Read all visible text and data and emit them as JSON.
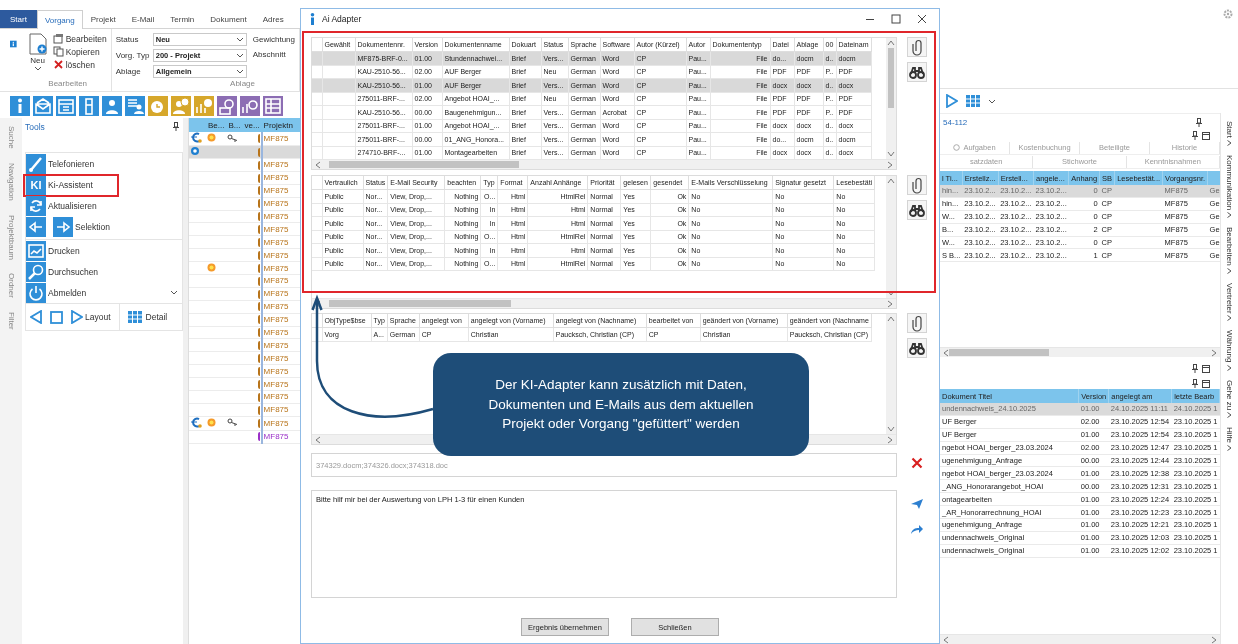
{
  "ribbon_tabs": [
    {
      "label": "Start",
      "kind": "file",
      "selected": false
    },
    {
      "label": "Vorgang",
      "kind": "tab",
      "selected": true
    },
    {
      "label": "Projekt",
      "kind": "tab",
      "selected": false
    },
    {
      "label": "E-Mail",
      "kind": "tab",
      "selected": false
    },
    {
      "label": "Termin",
      "kind": "tab",
      "selected": false
    },
    {
      "label": "Dokument",
      "kind": "tab",
      "selected": false
    },
    {
      "label": "Adres",
      "kind": "tab",
      "selected": false
    }
  ],
  "ribbon": {
    "new_label": "Neu",
    "actions": [
      "Bearbeiten",
      "Kopieren",
      "löschen"
    ],
    "edit_group": "Bearbeiten",
    "fields": [
      {
        "label": "Status",
        "value": "Neu"
      },
      {
        "label": "Vorg. Typ",
        "value": "200 - Projekt"
      },
      {
        "label": "Ablage",
        "value": "Allgemein"
      }
    ],
    "more_labels": [
      "Gewichtung",
      "Abschnitt"
    ],
    "filing_group": "Ablage"
  },
  "side_tabs_left": [
    "Suche",
    "Navigation",
    "Projektbaum",
    "Ordner",
    "Filter"
  ],
  "tools": {
    "title": "Tools",
    "items": [
      {
        "label": "Telefonieren",
        "highlighted": false
      },
      {
        "label": "Ki-Assistent",
        "badge": "KI",
        "highlighted": true
      },
      {
        "label": "Aktualisieren",
        "highlighted": false
      },
      {
        "label": "Selektion",
        "highlighted": false
      },
      {
        "label": "Drucken",
        "highlighted": false
      },
      {
        "label": "Durchsuchen",
        "highlighted": false
      },
      {
        "label": "Abmelden",
        "highlighted": false
      }
    ],
    "layout_label": "Layout",
    "detail_label": "Detail"
  },
  "project_grid": {
    "columns": [
      "Be...",
      "B...",
      "ve...",
      "Projektn"
    ],
    "rows": [
      {
        "kind": "full",
        "project": "MF875",
        "color": "#b8741a",
        "selected": false
      },
      {
        "kind": "config",
        "color": "#b8741a",
        "selected": true
      },
      {
        "kind": "plain",
        "project": "MF875",
        "color": "#b8741a",
        "selected": false
      },
      {
        "kind": "plain",
        "project": "MF875",
        "color": "#b8741a",
        "selected": false
      },
      {
        "kind": "plain",
        "project": "MF875",
        "color": "#b8741a",
        "selected": false
      },
      {
        "kind": "plain",
        "project": "MF875",
        "color": "#b8741a",
        "selected": false
      },
      {
        "kind": "plain",
        "project": "MF875",
        "color": "#b8741a",
        "selected": false
      },
      {
        "kind": "plain",
        "project": "MF875",
        "color": "#b8741a",
        "selected": false
      },
      {
        "kind": "plain",
        "project": "MF875",
        "color": "#b8741a",
        "selected": false
      },
      {
        "kind": "plain",
        "project": "MF875",
        "color": "#b8741a",
        "selected": false
      },
      {
        "kind": "sun",
        "project": "MF875",
        "color": "#b8741a",
        "selected": false
      },
      {
        "kind": "plain",
        "project": "MF875",
        "color": "#b8741a",
        "selected": false
      },
      {
        "kind": "plain",
        "project": "MF875",
        "color": "#b8741a",
        "selected": false
      },
      {
        "kind": "plain",
        "project": "MF875",
        "color": "#b8741a",
        "selected": false
      },
      {
        "kind": "plain",
        "project": "MF875",
        "color": "#b8741a",
        "selected": false
      },
      {
        "kind": "plain",
        "project": "MF875",
        "color": "#b8741a",
        "selected": false
      },
      {
        "kind": "plain",
        "project": "MF875",
        "color": "#b8741a",
        "selected": false
      },
      {
        "kind": "plain",
        "project": "MF875",
        "color": "#b8741a",
        "selected": false
      },
      {
        "kind": "plain",
        "project": "MF875",
        "color": "#b8741a",
        "selected": false
      },
      {
        "kind": "plain",
        "project": "MF875",
        "color": "#b8741a",
        "selected": false
      },
      {
        "kind": "plain",
        "project": "MF875",
        "color": "#b8741a",
        "selected": false
      },
      {
        "kind": "plain",
        "project": "MF875",
        "color": "#b8741a",
        "selected": false
      },
      {
        "kind": "full",
        "project": "MF875",
        "color": "#b8741a",
        "selected": false
      },
      {
        "kind": "plain",
        "project": "MF875",
        "color": "#9b30c8",
        "selected": false
      }
    ]
  },
  "dialog": {
    "title": "Ai Adapter",
    "highlighted": true,
    "documents": {
      "columns": [
        "Gewählt",
        "Dokumentennr.",
        "Version",
        "Dokumentenname",
        "Dokuart",
        "Status",
        "Sprache",
        "Software",
        "Autor (Kürzel)",
        "Autor",
        "Dokumententyp",
        "Datei",
        "Ablage",
        "00",
        "Dateinam"
      ],
      "rows": [
        {
          "cells": [
            null,
            "MF875-BRF-0...",
            "01.00",
            "Stundennachwei...",
            "Brief",
            "Vers...",
            "German",
            "Word",
            "CP",
            "Pau...",
            "File",
            "do...",
            "docm",
            "d..",
            "docm"
          ],
          "selected": true
        },
        {
          "cells": [
            null,
            "KAU-2510-56...",
            "02.00",
            "AUF Berger",
            "Brief",
            "Neu",
            "German",
            "Word",
            "CP",
            "Pau...",
            "File",
            "PDF",
            "PDF",
            "P..",
            "PDF"
          ],
          "selected": false
        },
        {
          "cells": [
            null,
            "KAU-2510-56...",
            "01.00",
            "AUF Berger",
            "Brief",
            "Vers...",
            "German",
            "Word",
            "CP",
            "Pau...",
            "File",
            "docx",
            "docx",
            "d..",
            "docx"
          ],
          "selected": true
        },
        {
          "cells": [
            null,
            "275011-BRF-...",
            "02.00",
            "Angebot HOAI_...",
            "Brief",
            "Neu",
            "German",
            "Word",
            "CP",
            "Pau...",
            "File",
            "PDF",
            "PDF",
            "P..",
            "PDF"
          ],
          "selected": false
        },
        {
          "cells": [
            null,
            "KAU-2510-56...",
            "00.00",
            "Baugenehmigun...",
            "Brief",
            "Vers...",
            "German",
            "Acrobat",
            "CP",
            "Pau...",
            "File",
            "PDF",
            "PDF",
            "P..",
            "PDF"
          ],
          "selected": false
        },
        {
          "cells": [
            null,
            "275011-BRF-...",
            "01.00",
            "Angebot HOAI_...",
            "Brief",
            "Vers...",
            "German",
            "Word",
            "CP",
            "Pau...",
            "File",
            "docx",
            "docx",
            "d..",
            "docx"
          ],
          "selected": false
        },
        {
          "cells": [
            null,
            "275011-BRF-...",
            "00.00",
            "01_ANG_Honora...",
            "Brief",
            "Vers...",
            "German",
            "Word",
            "CP",
            "Pau...",
            "File",
            "do...",
            "docm",
            "d..",
            "docm"
          ],
          "selected": false
        },
        {
          "cells": [
            null,
            "274710-BRF-...",
            "01.00",
            "Montagearbeiten",
            "Brief",
            "Vers...",
            "German",
            "Word",
            "CP",
            "Pau...",
            "File",
            "docx",
            "docx",
            "d..",
            "docx"
          ],
          "selected": false
        }
      ]
    },
    "emails": {
      "columns": [
        "Vertraulich",
        "Status",
        "E-Mail Security",
        "beachten",
        "Typ",
        "Format",
        "Anzahl Anhänge",
        "Priorität",
        "gelesen",
        "gesendet",
        "E-Mails Verschlüsselung",
        "Signatur gesetzt",
        "Lesebestäti"
      ],
      "rows": [
        {
          "cells": [
            "Public",
            "Nor...",
            "View, Drop,...",
            "Nothing",
            "O...",
            "Html",
            "HtmlRel",
            "Normal",
            "Yes",
            "Ok",
            "No",
            "No",
            "No"
          ],
          "selected": false
        },
        {
          "cells": [
            "Public",
            "Nor...",
            "View, Drop,...",
            "Nothing",
            "In",
            "Html",
            "Html",
            "Normal",
            "Yes",
            "Ok",
            "No",
            "No",
            "No"
          ],
          "selected": false
        },
        {
          "cells": [
            "Public",
            "Nor...",
            "View, Drop,...",
            "Nothing",
            "In",
            "Html",
            "Html",
            "Normal",
            "Yes",
            "Ok",
            "No",
            "No",
            "No"
          ],
          "selected": false
        },
        {
          "cells": [
            "Public",
            "Nor...",
            "View, Drop,...",
            "Nothing",
            "O...",
            "Html",
            "HtmlRel",
            "Normal",
            "Yes",
            "Ok",
            "No",
            "No",
            "No"
          ],
          "selected": false
        },
        {
          "cells": [
            "Public",
            "Nor...",
            "View, Drop,...",
            "Nothing",
            "In",
            "Html",
            "Html",
            "Normal",
            "Yes",
            "Ok",
            "No",
            "No",
            "No"
          ],
          "selected": false
        },
        {
          "cells": [
            "Public",
            "Nor...",
            "View, Drop,...",
            "Nothing",
            "O...",
            "Html",
            "HtmlRel",
            "Normal",
            "Yes",
            "Ok",
            "No",
            "No",
            "No"
          ],
          "selected": false
        }
      ]
    },
    "objects": {
      "columns": [
        "ObjType$bse",
        "Typ",
        "Sprache",
        "angelegt von",
        "angelegt von (Vorname)",
        "angelegt von (Nachname)",
        "bearbeitet von",
        "geändert von (Vorname)",
        "geändert von (Nachname"
      ],
      "rows": [
        {
          "cells": [
            "Vorg",
            "A...",
            "German",
            "CP",
            "Christian",
            "Paucksch, Christian (CP)",
            "CP",
            "Christian",
            "Paucksch, Christian (CP)"
          ],
          "selected": false
        }
      ]
    },
    "attachments": "374329.docm;374326.docx;374318.doc",
    "prompt": "Bitte hilf mir bei der Auswertung von LPH 1-3 für einen Kunden",
    "buttons": [
      "Ergebnis übernehmen",
      "Schließen"
    ],
    "callout": "Der KI-Adapter kann zusätzlich mit Daten, Dokumenten und E-Mails aus dem aktuellen Projekt oder Vorgang \"gefüttert\" werden"
  },
  "detail": {
    "code": "54-112",
    "tabs_row1": [
      {
        "label": "Aufgaben",
        "selected": false
      },
      {
        "label": "Kostenbuchung",
        "selected": false
      },
      {
        "label": "Beteiligte",
        "selected": false
      },
      {
        "label": "Historie",
        "selected": false
      }
    ],
    "tabs_row2": [
      {
        "label": "satzdaten",
        "selected": false
      },
      {
        "label": "Stichworte",
        "selected": false
      },
      {
        "label": "Kenntnisnahmen",
        "selected": false
      }
    ],
    "table": {
      "columns": [
        "l Ti...",
        "Erstellz...",
        "Erstell...",
        "angele...",
        "Anhang",
        "SB",
        "Lesebestät...",
        "Vorgangsnr.",
        null
      ],
      "rows": [
        {
          "cells": [
            "hin...",
            "23.10.2...",
            "23.10.2...",
            "23.10.2...",
            "0",
            "CP",
            null,
            "MF875",
            "Ge"
          ],
          "selected": true
        },
        {
          "cells": [
            "hin...",
            "23.10.2...",
            "23.10.2...",
            "23.10.2...",
            "0",
            "CP",
            null,
            "MF875",
            "Ge"
          ],
          "selected": false
        },
        {
          "cells": [
            "W...",
            "23.10.2...",
            "23.10.2...",
            "23.10.2...",
            "0",
            "CP",
            null,
            "MF875",
            "Ge"
          ],
          "selected": false
        },
        {
          "cells": [
            "B...",
            "23.10.2...",
            "23.10.2...",
            "23.10.2...",
            "2",
            "CP",
            null,
            "MF875",
            "Ge"
          ],
          "selected": false
        },
        {
          "cells": [
            "W...",
            "23.10.2...",
            "23.10.2...",
            "23.10.2...",
            "0",
            "CP",
            null,
            "MF875",
            "Ge"
          ],
          "selected": false
        },
        {
          "cells": [
            "S B...",
            "23.10.2...",
            "23.10.2...",
            "23.10.2...",
            "1",
            "CP",
            null,
            "MF875",
            "Ge"
          ],
          "selected": false
        }
      ]
    },
    "documents": {
      "columns": [
        "Dokument Titel",
        "Version",
        "angelegt am",
        "letzte Bearb"
      ],
      "rows": [
        {
          "cells": [
            "undennachweis_24.10.2025",
            "01.00",
            "24.10.2025 11:11",
            "24.10.2025 1"
          ],
          "selected": true
        },
        {
          "cells": [
            "UF Berger",
            "02.00",
            "23.10.2025 12:54",
            "23.10.2025 1"
          ],
          "selected": false
        },
        {
          "cells": [
            "UF Berger",
            "01.00",
            "23.10.2025 12:54",
            "23.10.2025 1"
          ],
          "selected": false
        },
        {
          "cells": [
            "ngebot HOAI_berger_23.03.2024",
            "02.00",
            "23.10.2025 12:47",
            "23.10.2025 1"
          ],
          "selected": false
        },
        {
          "cells": [
            "ugenehmigung_Anfrage",
            "00.00",
            "23.10.2025 12:44",
            "23.10.2025 1"
          ],
          "selected": false
        },
        {
          "cells": [
            "ngebot HOAI_berger_23.03.2024",
            "01.00",
            "23.10.2025 12:38",
            "23.10.2025 1"
          ],
          "selected": false
        },
        {
          "cells": [
            "_ANG_Honorarangebot_HOAI",
            "00.00",
            "23.10.2025 12:31",
            "23.10.2025 1"
          ],
          "selected": false
        },
        {
          "cells": [
            "ontagearbeiten",
            "01.00",
            "23.10.2025 12:24",
            "23.10.2025 1"
          ],
          "selected": false
        },
        {
          "cells": [
            "_AR_Honorarrechnung_HOAI",
            "01.00",
            "23.10.2025 12:23",
            "23.10.2025 1"
          ],
          "selected": false
        },
        {
          "cells": [
            "ugenehmigung_Anfrage",
            "01.00",
            "23.10.2025 12:21",
            "23.10.2025 1"
          ],
          "selected": false
        },
        {
          "cells": [
            "undennachweis_Original",
            "01.00",
            "23.10.2025 12:03",
            "23.10.2025 1"
          ],
          "selected": false
        },
        {
          "cells": [
            "undennachweis_Original",
            "01.00",
            "23.10.2025 12:02",
            "23.10.2025 1"
          ],
          "selected": false
        }
      ]
    }
  },
  "side_tabs_right": [
    "Start",
    "Kommunikation",
    "Bearbeiten",
    "Vertreter",
    "Währung",
    "Gehe zu",
    "Hilfe"
  ]
}
